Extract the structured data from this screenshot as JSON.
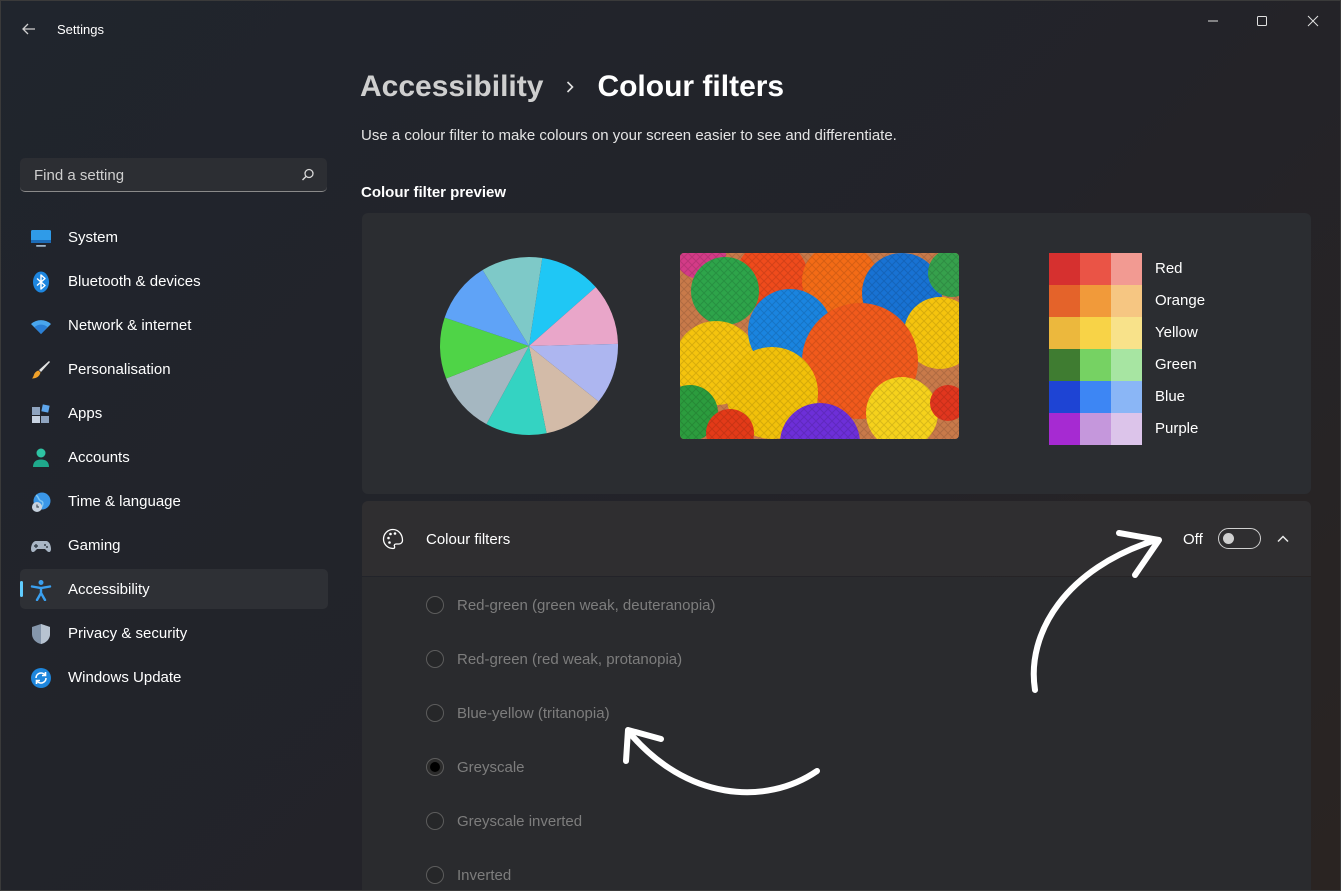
{
  "window": {
    "title": "Settings"
  },
  "search": {
    "placeholder": "Find a setting"
  },
  "sidebar": {
    "items": [
      {
        "label": "System",
        "icon": "monitor-icon"
      },
      {
        "label": "Bluetooth & devices",
        "icon": "bluetooth-icon"
      },
      {
        "label": "Network & internet",
        "icon": "wifi-icon"
      },
      {
        "label": "Personalisation",
        "icon": "brush-icon"
      },
      {
        "label": "Apps",
        "icon": "apps-icon"
      },
      {
        "label": "Accounts",
        "icon": "person-icon"
      },
      {
        "label": "Time & language",
        "icon": "globe-clock-icon"
      },
      {
        "label": "Gaming",
        "icon": "gamepad-icon"
      },
      {
        "label": "Accessibility",
        "icon": "accessibility-icon",
        "active": true
      },
      {
        "label": "Privacy & security",
        "icon": "shield-icon"
      },
      {
        "label": "Windows Update",
        "icon": "update-icon"
      }
    ]
  },
  "breadcrumb": {
    "parent": "Accessibility",
    "current": "Colour filters"
  },
  "description": "Use a colour filter to make colours on your screen easier to see and differentiate.",
  "preview": {
    "title": "Colour filter preview",
    "pie_colors": [
      "#1fc7f5",
      "#e9a6c9",
      "#adb6f0",
      "#d3bba8",
      "#34d3c2",
      "#a5b7c1",
      "#4fd447",
      "#5fa3f7",
      "#7ec9c8"
    ],
    "swatches": [
      {
        "label": "Red",
        "colors": [
          "#d6302f",
          "#ea5446",
          "#f29a92"
        ]
      },
      {
        "label": "Orange",
        "colors": [
          "#e4632a",
          "#f19a3a",
          "#f6c682"
        ]
      },
      {
        "label": "Yellow",
        "colors": [
          "#ecb83d",
          "#f8d347",
          "#f8e28a"
        ]
      },
      {
        "label": "Green",
        "colors": [
          "#3f7c31",
          "#76d263",
          "#a7e5a2"
        ]
      },
      {
        "label": "Blue",
        "colors": [
          "#1e44d4",
          "#3d86f4",
          "#8ab6f6"
        ]
      },
      {
        "label": "Purple",
        "colors": [
          "#a62ad2",
          "#c597dc",
          "#dcc4ea"
        ]
      }
    ]
  },
  "filter": {
    "title": "Colour filters",
    "toggle_state": "Off",
    "toggle_on": false,
    "options": [
      {
        "label": "Red-green (green weak, deuteranopia)",
        "checked": false
      },
      {
        "label": "Red-green (red weak, protanopia)",
        "checked": false
      },
      {
        "label": "Blue-yellow (tritanopia)",
        "checked": false
      },
      {
        "label": "Greyscale",
        "checked": true
      },
      {
        "label": "Greyscale inverted",
        "checked": false
      },
      {
        "label": "Inverted",
        "checked": false
      }
    ]
  },
  "colors": {
    "accent": "#60cdff",
    "background": "#212429",
    "card": "#2b2d31"
  }
}
